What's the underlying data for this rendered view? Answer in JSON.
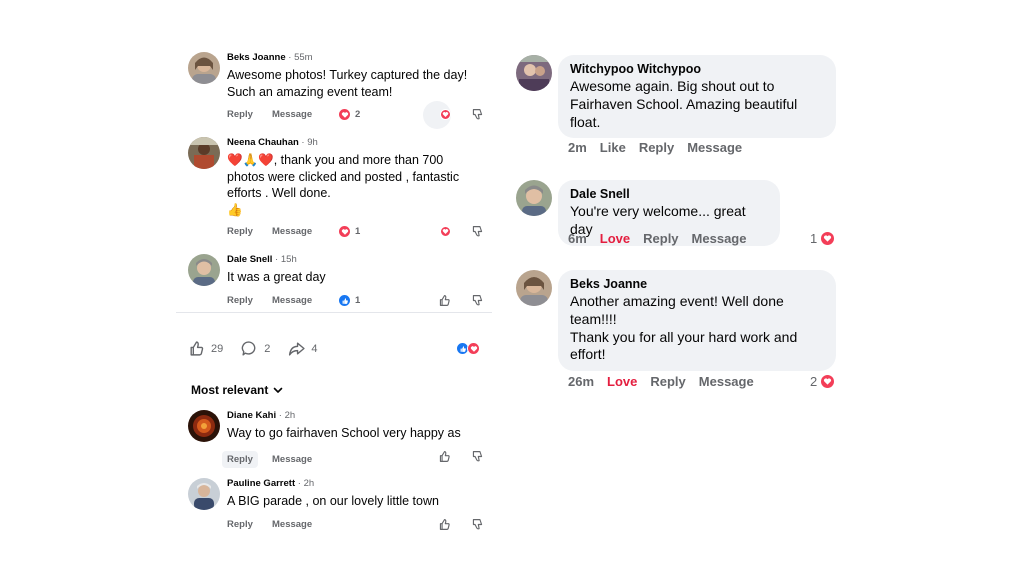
{
  "colors": {
    "love": "#f33e58",
    "like": "#1877f2",
    "love_text": "#e41e3f",
    "bubble": "#f0f2f5",
    "meta": "#65676b"
  },
  "left_comments": [
    {
      "name": "Beks Joanne",
      "time": "55m",
      "text_lines": [
        "Awesome photos! Turkey captured the day!",
        "Such an amazing event team!"
      ],
      "reply": "Reply",
      "message": "Message",
      "reaction_count": "2",
      "reaction": "love-icon"
    },
    {
      "name": "Neena Chauhan",
      "time": "9h",
      "text_lines": [
        "❤️🙏❤️, thank you and more than 700",
        "photos were clicked and posted , fantastic",
        "efforts .  Well done.",
        "👍"
      ],
      "reply": "Reply",
      "message": "Message",
      "reaction_count": "1",
      "reaction": "love-icon"
    },
    {
      "name": "Dale Snell",
      "time": "15h",
      "text_lines": [
        "It was a great day"
      ],
      "reply": "Reply",
      "message": "Message",
      "reaction_count": "1",
      "reaction": "like-icon"
    }
  ],
  "post_stats": {
    "likes": "29",
    "comments": "2",
    "shares": "4"
  },
  "sort_label": "Most relevant",
  "bottom_comments": [
    {
      "name": "Diane Kahi",
      "time": "2h",
      "text": "Way to go fairhaven School very happy as",
      "reply": "Reply",
      "message": "Message"
    },
    {
      "name": "Pauline Garrett",
      "time": "2h",
      "text": "A BIG parade , on our lovely little town",
      "reply": "Reply",
      "message": "Message"
    }
  ],
  "right_comments": [
    {
      "name": "Witchypoo Witchypoo",
      "text_lines": [
        "Awesome again. Big shout out to",
        "Fairhaven School. Amazing beautiful",
        "float."
      ],
      "time": "2m",
      "like": "Like",
      "reply": "Reply",
      "message": "Message"
    },
    {
      "name": "Dale Snell",
      "text_lines": [
        "You're very welcome... great day"
      ],
      "time": "6m",
      "like": "Love",
      "reply": "Reply",
      "message": "Message",
      "reaction_count": "1"
    },
    {
      "name": "Beks Joanne",
      "text_lines": [
        "Another amazing event! Well done",
        "team!!!!",
        "Thank you for all your hard work and",
        "effort!"
      ],
      "time": "26m",
      "like": "Love",
      "reply": "Reply",
      "message": "Message",
      "reaction_count": "2"
    }
  ]
}
